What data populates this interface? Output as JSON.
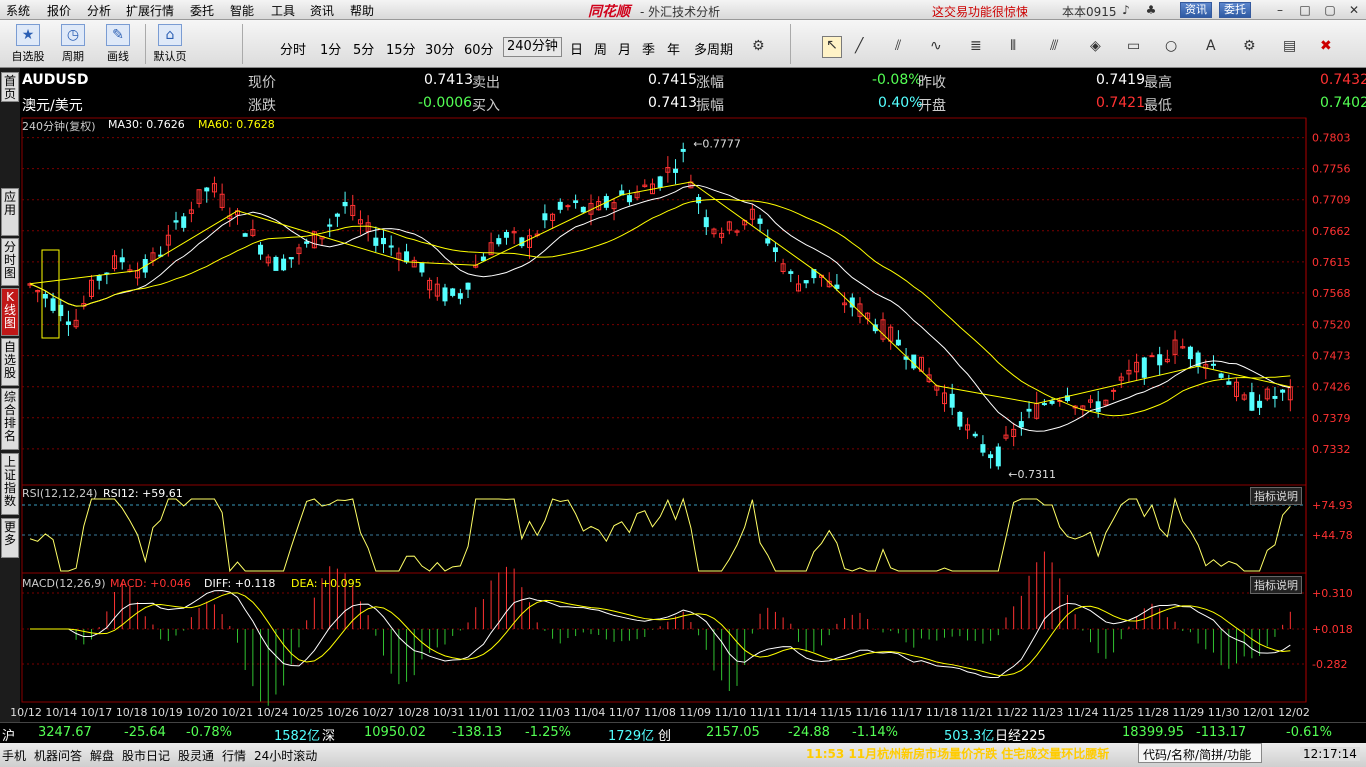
{
  "menu": {
    "items": [
      "系统",
      "报价",
      "分析",
      "扩展行情",
      "委托",
      "智能",
      "工具",
      "资讯",
      "帮助"
    ],
    "brand": "同花顺",
    "app_title": "- 外汇技术分析",
    "promo": "这交易功能很惊悚",
    "version": "本本0915",
    "btn_news": "资讯",
    "btn_trade": "委托"
  },
  "toolbar": {
    "self_select": "自选股",
    "period": "周期",
    "draw": "画线",
    "default_page": "默认页",
    "periods": [
      "分时",
      "1分",
      "5分",
      "15分",
      "30分",
      "60分",
      "240分钟",
      "日",
      "周",
      "月",
      "季",
      "年",
      "多周期"
    ],
    "active_period": "240分钟"
  },
  "sidebar": {
    "tabs": [
      "首页",
      "应用",
      "分时图",
      "K线图",
      "自选股",
      "综合排名",
      "上证指数",
      "更多"
    ],
    "active": "K线图"
  },
  "quote": {
    "symbol": "AUDUSD",
    "name": "澳元/美元",
    "label_now": "现价",
    "now": "0.7413",
    "label_sell": "卖出",
    "sell": "0.7415",
    "label_pct": "涨幅",
    "pct": "-0.08%",
    "label_prev": "昨收",
    "prev": "0.7419",
    "label_high": "最高",
    "high": "0.7432",
    "label_chg": "涨跌",
    "chg": "-0.0006",
    "label_buy": "买入",
    "buy": "0.7413",
    "label_amp": "振幅",
    "amp": "0.40%",
    "label_open": "开盘",
    "open": "0.7421",
    "label_low": "最低",
    "low": "0.7402"
  },
  "chart_data": [
    {
      "type": "candlestick",
      "title": "240分钟(复权)",
      "ma30_label": "MA30: 0.7626",
      "ma60_label": "MA60: 0.7628",
      "ylim": [
        0.73,
        0.781
      ],
      "y_ticks": [
        "0.7803",
        "0.7756",
        "0.7709",
        "0.7662",
        "0.7615",
        "0.7568",
        "0.7520",
        "0.7473",
        "0.7426",
        "0.7379",
        "0.7332"
      ],
      "annotations": [
        {
          "label": "0.7777"
        },
        {
          "label": "0.7311"
        }
      ],
      "x_ticks": [
        "10/12",
        "10/14",
        "10/17",
        "10/18",
        "10/19",
        "10/20",
        "10/21",
        "10/24",
        "10/25",
        "10/26",
        "10/27",
        "10/28",
        "10/31",
        "11/01",
        "11/02",
        "11/03",
        "11/04",
        "11/07",
        "11/08",
        "11/09",
        "11/10",
        "11/11",
        "11/14",
        "11/15",
        "11/16",
        "11/17",
        "11/18",
        "11/21",
        "11/22",
        "11/23",
        "11/24",
        "11/25",
        "11/28",
        "11/29",
        "11/30",
        "12/01",
        "12/02"
      ],
      "close_path": [
        0.758,
        0.7555,
        0.7525,
        0.759,
        0.762,
        0.76,
        0.764,
        0.769,
        0.773,
        0.769,
        0.765,
        0.761,
        0.763,
        0.766,
        0.77,
        0.766,
        0.764,
        0.762,
        0.757,
        0.756,
        0.762,
        0.7655,
        0.764,
        0.768,
        0.77,
        0.769,
        0.771,
        0.772,
        0.774,
        0.7777,
        0.768,
        0.766,
        0.769,
        0.764,
        0.758,
        0.76,
        0.756,
        0.754,
        0.751,
        0.748,
        0.744,
        0.74,
        0.734,
        0.732,
        0.737,
        0.74,
        0.742,
        0.739,
        0.741,
        0.745,
        0.746,
        0.749,
        0.747,
        0.745,
        0.74,
        0.741,
        0.7413
      ]
    },
    {
      "type": "line",
      "title": "RSI(12,12,24)",
      "value_label": "RSI12: +59.61",
      "y_ticks": [
        "+74.93",
        "+44.78"
      ]
    },
    {
      "type": "bar",
      "title": "MACD(12,26,9)",
      "macd_label": "MACD: +0.046",
      "diff_label": "DIFF: +0.118",
      "dea_label": "DEA: +0.095",
      "y_ticks": [
        "+0.310",
        "+0.018",
        "-0.282"
      ]
    }
  ],
  "indicator_help": "指标说明",
  "indices": {
    "sh_label": "沪",
    "sh_val": "3247.67",
    "sh_chg": "-25.64",
    "sh_pct": "-0.78%",
    "sh_vol": "1582亿",
    "sz_label": "深",
    "sz_val": "10950.02",
    "sz_chg": "-138.13",
    "sz_pct": "-1.25%",
    "sz_vol": "1729亿",
    "cy_label": "创",
    "cy_val": "2157.05",
    "cy_chg": "-24.88",
    "cy_pct": "-1.14%",
    "cy_vol": "503.3亿",
    "nk_label": "日经225",
    "nk_val": "18399.95",
    "nk_chg": "-113.17",
    "nk_pct": "-0.61%"
  },
  "bottom": {
    "links": [
      "手机",
      "机器问答",
      "解盘",
      "股市日记",
      "股灵通",
      "行情",
      "24小时滚动"
    ],
    "news": "11:53 11月杭州新房市场量价齐跌 住宅成交量环比腰斩",
    "search": "代码/名称/简拼/功能",
    "clock": "12:17:14"
  },
  "colors": {
    "up": "#ff3232",
    "down": "#54ffff",
    "ma30": "#ffffff",
    "ma60": "#ffff00",
    "grid": "#7a0000"
  }
}
